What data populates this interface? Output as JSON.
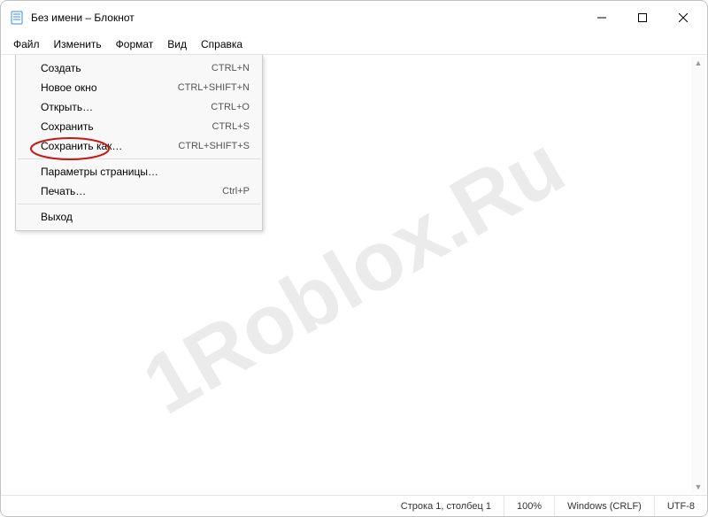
{
  "window": {
    "title": "Без имени – Блокнот"
  },
  "menubar": [
    "Файл",
    "Изменить",
    "Формат",
    "Вид",
    "Справка"
  ],
  "file_menu": {
    "groups": [
      [
        {
          "label": "Создать",
          "shortcut": "CTRL+N"
        },
        {
          "label": "Новое окно",
          "shortcut": "CTRL+SHIFT+N"
        },
        {
          "label": "Открыть…",
          "shortcut": "CTRL+O"
        },
        {
          "label": "Сохранить",
          "shortcut": "CTRL+S"
        },
        {
          "label": "Сохранить как…",
          "shortcut": "CTRL+SHIFT+S"
        }
      ],
      [
        {
          "label": "Параметры страницы…",
          "shortcut": ""
        },
        {
          "label": "Печать…",
          "shortcut": "Ctrl+P"
        }
      ],
      [
        {
          "label": "Выход",
          "shortcut": ""
        }
      ]
    ]
  },
  "status": {
    "position": "Строка 1, столбец 1",
    "zoom": "100%",
    "line_ending": "Windows (CRLF)",
    "encoding": "UTF-8"
  },
  "watermark": "1Roblox.Ru"
}
